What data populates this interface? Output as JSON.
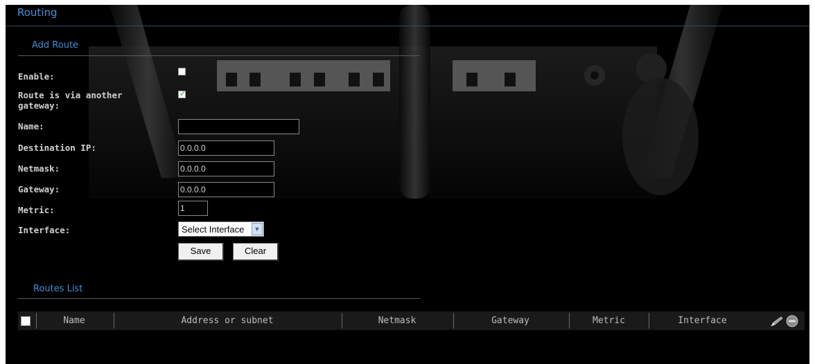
{
  "page": {
    "title": "Routing"
  },
  "add_route": {
    "section_title": "Add Route",
    "enable": {
      "label": "Enable:",
      "checked": false
    },
    "via_gateway": {
      "label": "Route is via another gateway:",
      "checked": true
    },
    "name": {
      "label": "Name:",
      "value": ""
    },
    "destination_ip": {
      "label": "Destination IP:",
      "value": "0.0.0.0"
    },
    "netmask": {
      "label": "Netmask:",
      "value": "0.0.0.0"
    },
    "gateway": {
      "label": "Gateway:",
      "value": "0.0.0.0"
    },
    "metric": {
      "label": "Metric:",
      "value": "1"
    },
    "interface": {
      "label": "Interface:",
      "selected": "Select Interface"
    },
    "save_label": "Save",
    "clear_label": "Clear"
  },
  "routes_list": {
    "section_title": "Routes List",
    "columns": [
      "Name",
      "Address or subnet",
      "Netmask",
      "Gateway",
      "Metric",
      "Interface"
    ],
    "rows": []
  },
  "icons": {
    "edit": "edit-pencil-icon",
    "delete": "delete-circle-icon"
  },
  "colors": {
    "accent": "#3d8fd6",
    "background": "#000000",
    "check": "#16a53a"
  }
}
